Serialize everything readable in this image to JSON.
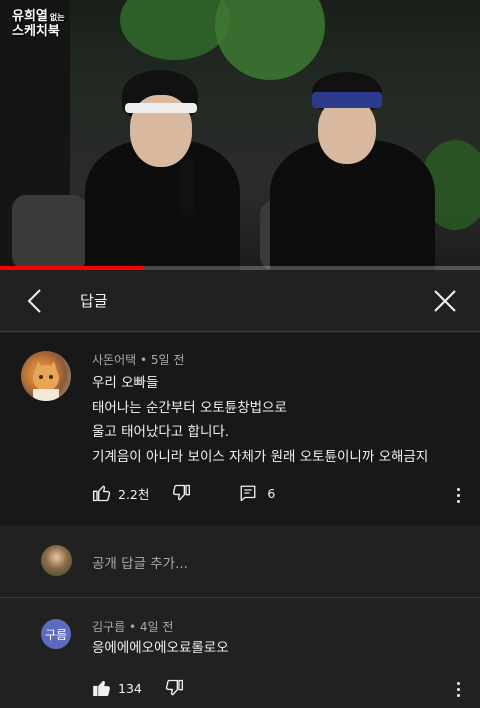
{
  "video": {
    "logo_line1": "유희열",
    "logo_small": "없는",
    "logo_line2": "스케치북",
    "progress": 0.3,
    "progress_color": "#ff0000"
  },
  "header": {
    "title": "답글",
    "back_icon": "chevron-left-icon",
    "close_icon": "close-icon"
  },
  "parent_comment": {
    "author": "사돈어택",
    "time": "5일 전",
    "lines": [
      "우리 오빠들",
      "태어나는 순간부터 오토튠창법으로",
      "울고 태어났다고 합니다.",
      "기계음이 아니라 보이스 자체가 원래 오토튠이니까 오해금지"
    ],
    "likes": "2.2천",
    "replies": "6"
  },
  "add_reply": {
    "placeholder": "공개 답글 추가..."
  },
  "reply": {
    "avatar_text": "구름",
    "author": "김구름",
    "time": "4일 전",
    "text": "응에에에오에오료롤로오",
    "likes": "134",
    "avatar_color": "#5c6bc0"
  }
}
